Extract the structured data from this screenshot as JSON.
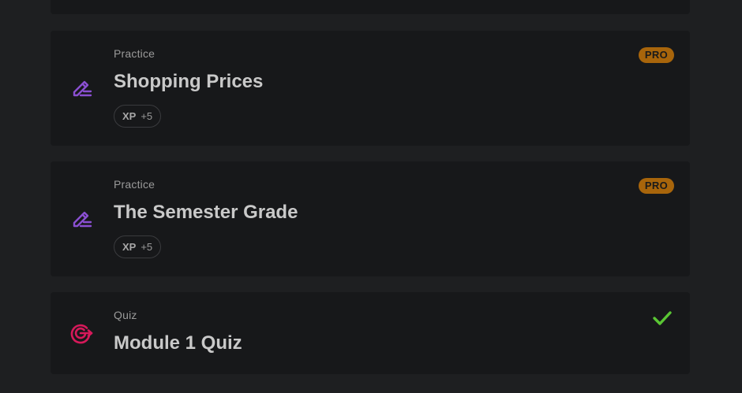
{
  "lessons": [
    {
      "kind": "Practice",
      "title": "Shopping Prices",
      "xp_label": "XP",
      "xp_value": "+5",
      "badge": "PRO",
      "icon": "pencil-icon"
    },
    {
      "kind": "Practice",
      "title": "The Semester Grade",
      "xp_label": "XP",
      "xp_value": "+5",
      "badge": "PRO",
      "icon": "pencil-icon"
    },
    {
      "kind": "Quiz",
      "title": "Module 1 Quiz",
      "status": "completed",
      "icon": "target-icon",
      "status_icon": "checkmark-icon"
    }
  ],
  "colors": {
    "background": "#1e1f21",
    "card": "#17181a",
    "practice_icon": "#8a4fd1",
    "quiz_icon": "#d6195a",
    "pro_badge": "#a8650b",
    "check": "#5ac634"
  }
}
